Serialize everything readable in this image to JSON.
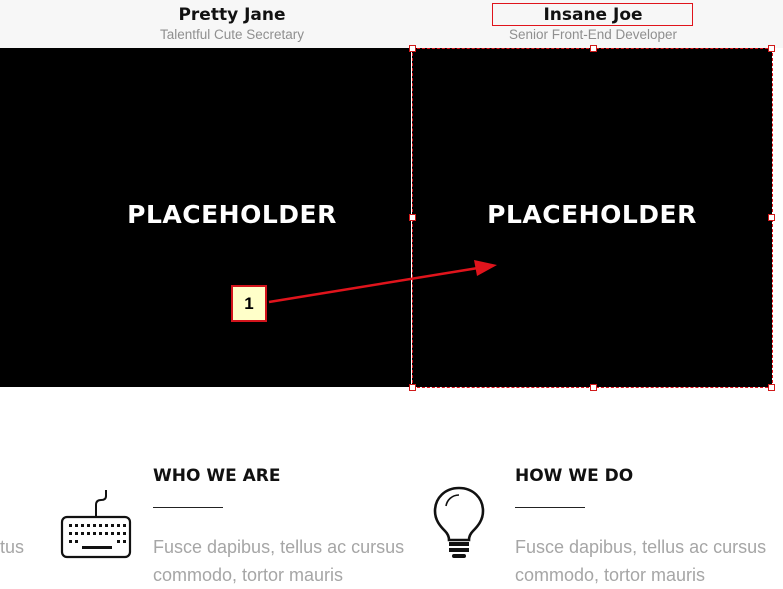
{
  "team": [
    {
      "name": "Pretty Jane",
      "role": "Talentful Cute Secretary",
      "photo_label": "PLACEHOLDER"
    },
    {
      "name": "Insane Joe",
      "role": "Senior Front-End Developer",
      "photo_label": "PLACEHOLDER"
    }
  ],
  "annotation": {
    "number": "1",
    "color": "#e0141c",
    "fill": "#ffffc9"
  },
  "features": [
    {
      "title": "WHO WE ARE",
      "icon": "keyboard-icon",
      "text": "Fusce dapibus, tellus ac cursus commodo, tortor mauris"
    },
    {
      "title": "HOW WE DO",
      "icon": "lightbulb-icon",
      "text": "Fusce dapibus, tellus ac cursus commodo, tortor mauris"
    }
  ],
  "edge_fragment": "tus"
}
